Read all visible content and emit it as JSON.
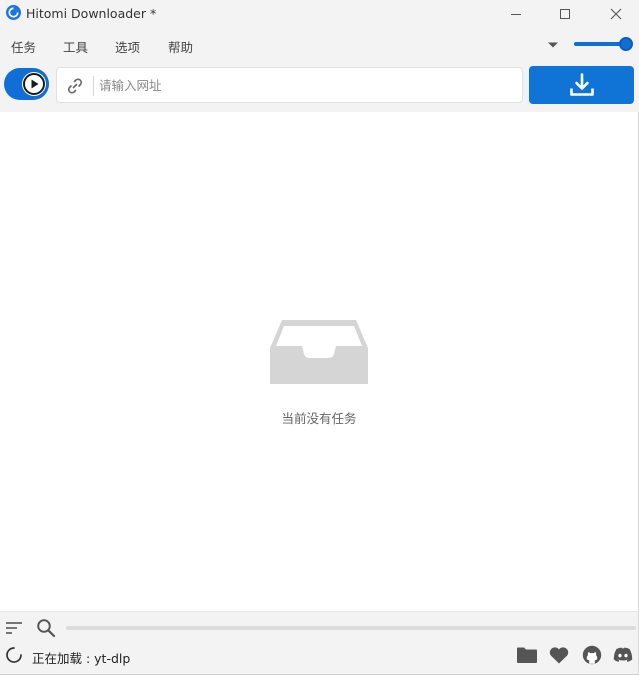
{
  "window": {
    "title": "Hitomi Downloader *"
  },
  "menu": {
    "items": [
      "任务",
      "工具",
      "选项",
      "帮助"
    ]
  },
  "volume_slider": {
    "level": 1.0
  },
  "toolbar": {
    "url_placeholder": "请输入网址",
    "url_value": ""
  },
  "content": {
    "empty_message": "当前没有任务"
  },
  "status": {
    "text": "正在加载 : yt-dlp"
  },
  "colors": {
    "accent": "#0f6fd6",
    "background": "#f3f3f3",
    "content_bg": "#ffffff",
    "icon_gray": "#555555",
    "empty_icon": "#d4d4d4"
  },
  "icons": {
    "app": "app-icon",
    "minimize": "minimize-icon",
    "maximize": "maximize-icon",
    "close": "close-icon",
    "dropdown": "chevron-down-icon",
    "play": "play-icon",
    "link": "link-icon",
    "download": "download-icon",
    "empty_tray": "inbox-tray-icon",
    "filter": "sort-filter-icon",
    "search": "search-icon",
    "spinner": "loading-spinner-icon",
    "folder": "folder-icon",
    "heart": "heart-icon",
    "github": "github-icon",
    "discord": "discord-icon"
  }
}
